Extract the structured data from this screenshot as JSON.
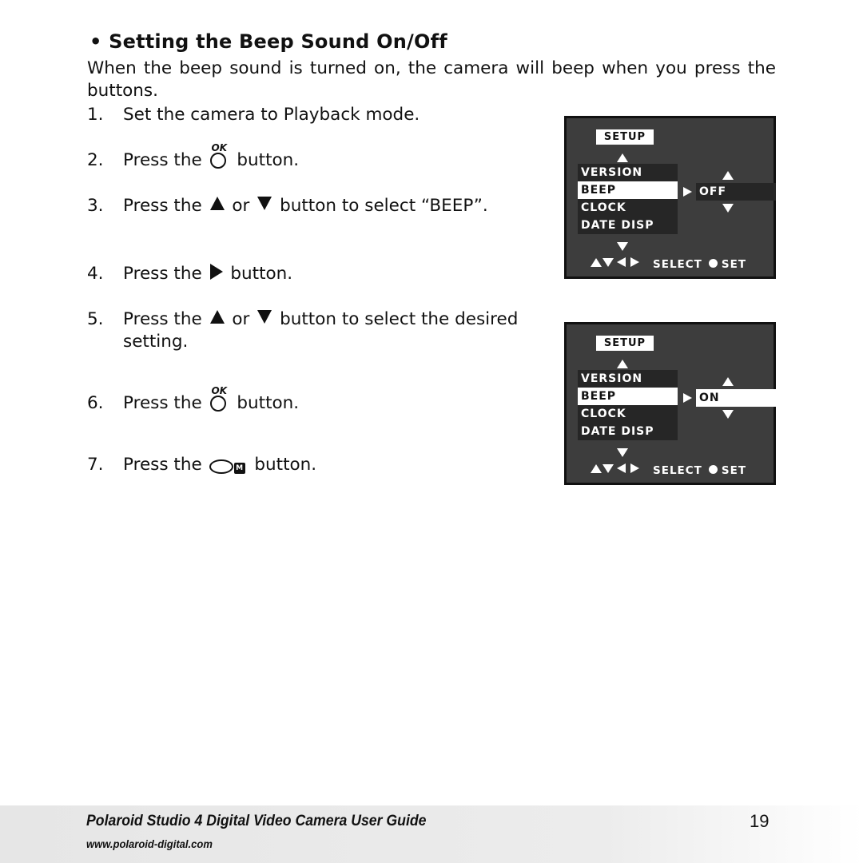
{
  "section": {
    "bullet": "•",
    "title": "Setting the Beep Sound On/Off",
    "intro": "When the beep sound is turned on, the camera will beep when you press the buttons."
  },
  "steps": [
    {
      "num": "1.",
      "text": "Set the camera to Playback mode."
    },
    {
      "num": "2.",
      "pre": "Press the",
      "icon": "ok-button-icon",
      "icon_label": "OK",
      "post": "button."
    },
    {
      "num": "3.",
      "pre": "Press the",
      "icon": "up-arrow-icon",
      "mid": "or",
      "icon2": "down-arrow-icon",
      "post": "button to select “BEEP”."
    },
    {
      "num": "4.",
      "pre": "Press the",
      "icon": "right-arrow-icon",
      "post": "button."
    },
    {
      "num": "5.",
      "pre": "Press the",
      "icon": "up-arrow-icon",
      "mid": "or",
      "icon2": "down-arrow-icon",
      "post": "button to select the desired",
      "cont": "setting."
    },
    {
      "num": "6.",
      "pre": "Press the",
      "icon": "ok-button-icon",
      "icon_label": "OK",
      "post": "button."
    },
    {
      "num": "7.",
      "pre": "Press the",
      "icon": "menu-button-icon",
      "icon_label": "M",
      "post": "button."
    }
  ],
  "screens": [
    {
      "header": "SETUP",
      "menu_items": [
        "VERSION",
        "BEEP",
        "CLOCK",
        "DATE DISP"
      ],
      "selected_item": "BEEP",
      "value": "OFF",
      "value_highlighted": false,
      "hint_select": "SELECT",
      "hint_set": "SET"
    },
    {
      "header": "SETUP",
      "menu_items": [
        "VERSION",
        "BEEP",
        "CLOCK",
        "DATE DISP"
      ],
      "selected_item": "BEEP",
      "value": "ON",
      "value_highlighted": true,
      "hint_select": "SELECT",
      "hint_set": "SET"
    }
  ],
  "footer": {
    "guide_title": "Polaroid Studio 4 Digital Video Camera User Guide",
    "page_number": "19",
    "url": "www.polaroid-digital.com"
  }
}
